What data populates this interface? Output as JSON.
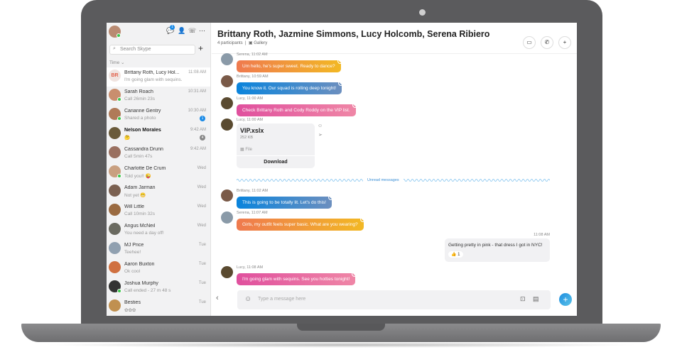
{
  "sidebar": {
    "search_placeholder": "Search Skype",
    "sort_label": "Time ⌄",
    "notif_count": "1",
    "chats": [
      {
        "name": "Brittany Roth, Lucy Hol...",
        "preview": "I'm going glam with sequins.",
        "time": "11:08 AM",
        "initials": "BR"
      },
      {
        "name": "Sarah Roach",
        "preview": "Call 26min 23s",
        "time": "10:31 AM"
      },
      {
        "name": "Carianne Gentry",
        "preview": "Shared a photo",
        "time": "10:30 AM",
        "badge": "1"
      },
      {
        "name": "Nelson Morales",
        "preview": "🤔",
        "time": "9:42 AM",
        "badge": "4"
      },
      {
        "name": "Cassandra Drunn",
        "preview": "Call 5min 47s",
        "time": "9:42 AM"
      },
      {
        "name": "Charlotte De Crum",
        "preview": "Told you!! 😜",
        "time": "Wed"
      },
      {
        "name": "Adam Jarman",
        "preview": "Not yet 😬",
        "time": "Wed"
      },
      {
        "name": "Will Little",
        "preview": "Call 10min 32s",
        "time": "Wed"
      },
      {
        "name": "Angus McNeil",
        "preview": "You need a day off!",
        "time": "Wed"
      },
      {
        "name": "MJ Price",
        "preview": "Teehee!",
        "time": "Tue"
      },
      {
        "name": "Aaron Buxton",
        "preview": "Ok cool",
        "time": "Tue"
      },
      {
        "name": "Joshua Murphy",
        "preview": "Call ended - 27 m 48 s",
        "time": "Tue"
      },
      {
        "name": "Besties",
        "preview": "✿✿✿",
        "time": "Tue"
      }
    ]
  },
  "header": {
    "title": "Brittany Roth, Jazmine Simmons, Lucy Holcomb, Serena Ribiero",
    "participants": "4 participants",
    "gallery": "Gallery"
  },
  "messages": [
    {
      "meta": "Serena, 11:02 AM",
      "text": "Um hello, he's super sweet. Ready to dance?"
    },
    {
      "meta": "Brittany, 10:59 AM",
      "text": "You know it. Our squad is rolling deep tonight!"
    },
    {
      "meta": "Lucy, 11:00 AM",
      "text": "Check Brittany Roth and Cody Roddy on the VIP list."
    },
    {
      "meta": "Lucy, 11:00 AM",
      "file_name": "VIP.xslx",
      "file_size": "252 KB",
      "file_type": "File",
      "download": "Download"
    },
    {
      "meta": "Brittany, 11:02 AM",
      "text": "This is going to be totally lit. Let's do this!"
    },
    {
      "meta": "Serena, 11:07 AM",
      "text": "Girls, my outfit feels super basic. What are you wearing?"
    },
    {
      "meta": "11:08 AM",
      "text": "Getting pretty in pink - that dress I got in NYC!",
      "reaction": "👍",
      "reaction_count": "1"
    },
    {
      "meta": "Lucy, 11:08 AM",
      "text": "I'm going glam with sequins. See you hotties tonight!"
    }
  ],
  "unread_label": "Unread messages",
  "composer": {
    "placeholder": "Type a message here"
  }
}
